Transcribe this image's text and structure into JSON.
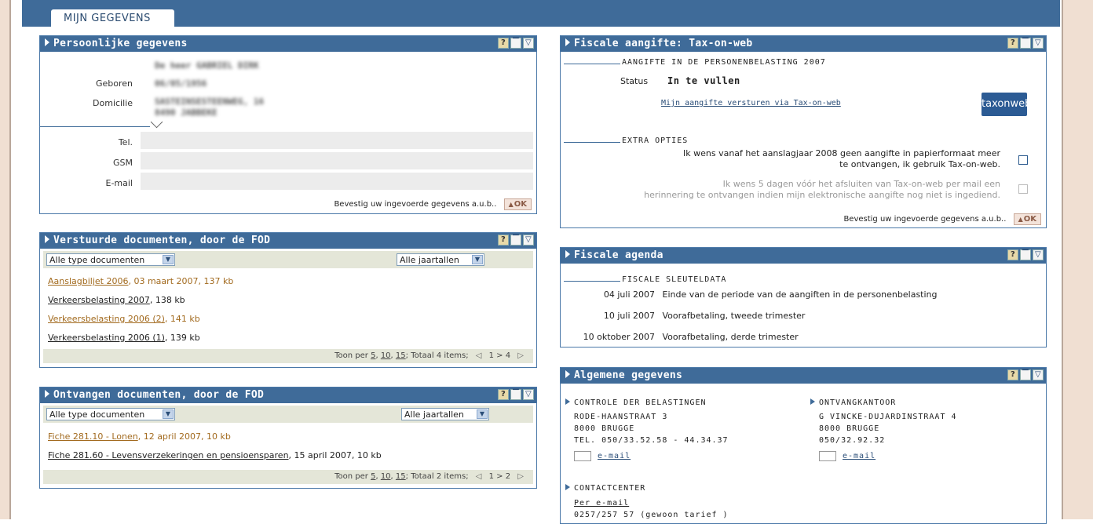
{
  "tab": {
    "label": "MIJN GEGEVENS"
  },
  "persoonlijk": {
    "title": "Persoonlijke gegevens",
    "name_blur": "De heer GABRIEL DIRK",
    "geboren_label": "Geboren",
    "geboren_blur": "06/05/1956",
    "domicilie_label": "Domicilie",
    "domicilie_blur1": "SASTEINSESTEENWEG, 16",
    "domicilie_blur2": "8490 JABBEKE",
    "tel_label": "Tel.",
    "tel_value": "",
    "gsm_label": "GSM",
    "gsm_value": "",
    "email_label": "E-mail",
    "email_value": "",
    "confirm": "Bevestig uw ingevoerde gegevens a.u.b..",
    "ok": "OK"
  },
  "verstuurd": {
    "title": "Verstuurde documenten, door de FOD",
    "type_select": "Alle type documenten",
    "jaar_select": "Alle jaartallen",
    "docs": [
      {
        "link": "Aanslagbiljet 2006",
        "rest": ", 03 maart 2007, 137 kb"
      },
      {
        "link": "Verkeersbelasting 2007",
        "rest": ", 138 kb"
      },
      {
        "link": "Verkeersbelasting 2006 (2)",
        "rest": ", 141 kb"
      },
      {
        "link": "Verkeersbelasting 2006 (1)",
        "rest": ", 139 kb"
      }
    ],
    "pager_prefix": "Toon per",
    "pager_5": "5",
    "pager_10": "10",
    "pager_15": "15",
    "pager_total": "; Totaal 4 items;",
    "pager_range": "1 > 4"
  },
  "ontvangen": {
    "title": "Ontvangen documenten, door de FOD",
    "type_select": "Alle type documenten",
    "jaar_select": "Alle jaartallen",
    "docs": [
      {
        "link": "Fiche 281.10 - Lonen",
        "rest": ", 12 april 2007, 10 kb"
      },
      {
        "link": "Fiche 281.60 - Levensverzekeringen en pensioensparen",
        "rest": ", 15 april 2007, 10 kb"
      }
    ],
    "pager_prefix": "Toon per",
    "pager_5": "5",
    "pager_10": "10",
    "pager_15": "15",
    "pager_total": "; Totaal 2 items;",
    "pager_range": "1 > 2"
  },
  "taxonweb": {
    "title": "Fiscale aangifte: Tax-on-web",
    "section1": "AANGIFTE IN DE PERSONENBELASTING 2007",
    "status_label": "Status",
    "status_value": "In te vullen",
    "link": "Mijn aangifte versturen via Tax-on-web",
    "logo": "taxonweb",
    "section2": "EXTRA OPTIES",
    "opt1_line1": "Ik wens vanaf het aanslagjaar 2008 geen aangifte in papierformaat meer",
    "opt1_line2": "te ontvangen, ik gebruik Tax-on-web.",
    "opt2_line1": "Ik wens 5 dagen vóór het afsluiten van Tax-on-web per mail een",
    "opt2_line2": "herinnering te ontvangen indien mijn elektronische aangifte nog niet is ingediend.",
    "confirm": "Bevestig uw ingevoerde gegevens a.u.b..",
    "ok": "OK"
  },
  "agenda": {
    "title": "Fiscale agenda",
    "section": "FISCALE SLEUTELDATA",
    "items": [
      {
        "date": "04 juli 2007",
        "text": "Einde van de periode van de aangiften in de personenbelasting"
      },
      {
        "date": "10 juli 2007",
        "text": "Voorafbetaling, tweede trimester"
      },
      {
        "date": "10 oktober 2007",
        "text": "Voorafbetaling, derde trimester"
      }
    ]
  },
  "algemeen": {
    "title": "Algemene gegevens",
    "controle": {
      "title": "CONTROLE DER BELASTINGEN",
      "addr1": "RODE-HAANSTRAAT 3",
      "addr2": "8000 BRUGGE",
      "tel": "TEL. 050/33.52.58 - 44.34.37",
      "email": "e-mail"
    },
    "ontvang": {
      "title": "ONTVANGKANTOOR",
      "addr1": "G VINCKE-DUJARDINSTRAAT 4",
      "addr2": "8000 BRUGGE",
      "tel": "050/32.92.32",
      "email": "e-mail"
    },
    "contact": {
      "title": "CONTACTCENTER",
      "link": "Per e-mail",
      "tel": "0257/257 57  (gewoon tarief )"
    }
  },
  "panel_buttons": {
    "help": "?",
    "min": "▔",
    "toggle": "▽"
  },
  "colors": {
    "header": "#3f6b99",
    "side": "#f0dfd2",
    "link_orange": "#a26a1e"
  }
}
